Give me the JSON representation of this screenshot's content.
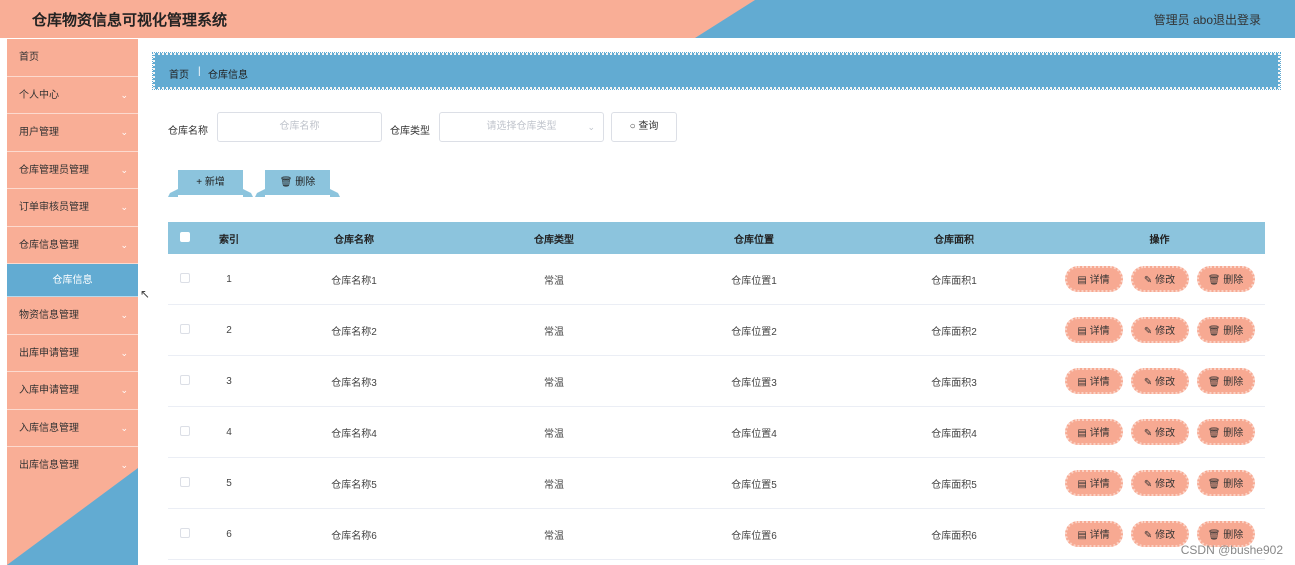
{
  "header": {
    "title": "仓库物资信息可视化管理系统",
    "admin": "管理员 abo",
    "logout": "退出登录"
  },
  "sidebar": {
    "items": [
      {
        "label": "首页",
        "chevron": ""
      },
      {
        "label": "个人中心",
        "chevron": "⌄"
      },
      {
        "label": "用户管理",
        "chevron": "⌄"
      },
      {
        "label": "仓库管理员管理",
        "chevron": "⌄"
      },
      {
        "label": "订单审核员管理",
        "chevron": "⌄"
      },
      {
        "label": "仓库信息管理",
        "chevron": "⌄"
      },
      {
        "label": "仓库信息",
        "chevron": ""
      },
      {
        "label": "物资信息管理",
        "chevron": "⌄"
      },
      {
        "label": "出库申请管理",
        "chevron": "⌄"
      },
      {
        "label": "入库申请管理",
        "chevron": "⌄"
      },
      {
        "label": "入库信息管理",
        "chevron": "⌄"
      },
      {
        "label": "出库信息管理",
        "chevron": "⌄"
      }
    ]
  },
  "breadcrumb": {
    "home": "首页",
    "sep": "|",
    "current": "仓库信息"
  },
  "search": {
    "name_label": "仓库名称",
    "name_placeholder": "仓库名称",
    "type_label": "仓库类型",
    "type_placeholder": "请选择仓库类型",
    "query_label": "查询"
  },
  "actions": {
    "add": "新增",
    "delete": "删除"
  },
  "table": {
    "headers": [
      "索引",
      "仓库名称",
      "仓库类型",
      "仓库位置",
      "仓库面积",
      "操作"
    ],
    "rows": [
      [
        "1",
        "仓库名称1",
        "常温",
        "仓库位置1",
        "仓库面积1"
      ],
      [
        "2",
        "仓库名称2",
        "常温",
        "仓库位置2",
        "仓库面积2"
      ],
      [
        "3",
        "仓库名称3",
        "常温",
        "仓库位置3",
        "仓库面积3"
      ],
      [
        "4",
        "仓库名称4",
        "常温",
        "仓库位置4",
        "仓库面积4"
      ],
      [
        "5",
        "仓库名称5",
        "常温",
        "仓库位置5",
        "仓库面积5"
      ],
      [
        "6",
        "仓库名称6",
        "常温",
        "仓库位置6",
        "仓库面积6"
      ]
    ],
    "op_labels": {
      "detail": "详情",
      "edit": "修改",
      "delete": "删除"
    }
  },
  "watermark": "CSDN @bushe902",
  "colors": {
    "salmon": "#f9ae96",
    "blue": "#62abd2",
    "light_blue": "#8cc4dd"
  }
}
